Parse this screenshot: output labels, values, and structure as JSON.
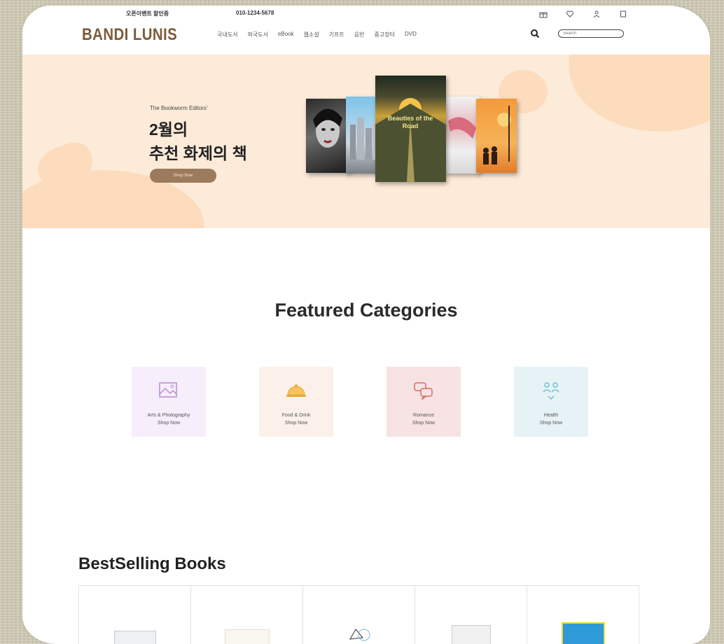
{
  "header": {
    "promo_left": "오픈이벤트 할인중",
    "promo_right": "010-1234-5678",
    "logo": "BANDI LUNIS",
    "nav": [
      "국내도서",
      "외국도서",
      "eBook",
      "웹소설",
      "기프트",
      "음반",
      "중고장터",
      "DVD"
    ],
    "search_placeholder": "Search"
  },
  "hero": {
    "kicker": "The Bookworm Editors'",
    "title_line1": "2월의",
    "title_line2": "추천 화제의 책",
    "button_label": "Shop Now",
    "featured_book_title": "Beauties of the Road"
  },
  "featured": {
    "title": "Featured Categories",
    "categories": [
      {
        "name": "Arts & Photography",
        "cta": "Shop Now",
        "bg": "#f6eefb",
        "icon": "picture-icon",
        "icon_color": "#b98ad0"
      },
      {
        "name": "Food & Drink",
        "cta": "Shop Now",
        "bg": "#fbf1ea",
        "icon": "cloche-icon",
        "icon_color": "#e9a83c"
      },
      {
        "name": "Romance",
        "cta": "Shop Now",
        "bg": "#f7e3e3",
        "icon": "speech-bubbles-icon",
        "icon_color": "#d96a6a"
      },
      {
        "name": "Health",
        "cta": "Shop Now",
        "bg": "#e7f2f6",
        "icon": "health-icon",
        "icon_color": "#67c3cf"
      }
    ]
  },
  "bestselling": {
    "title": "BestSelling Books"
  }
}
